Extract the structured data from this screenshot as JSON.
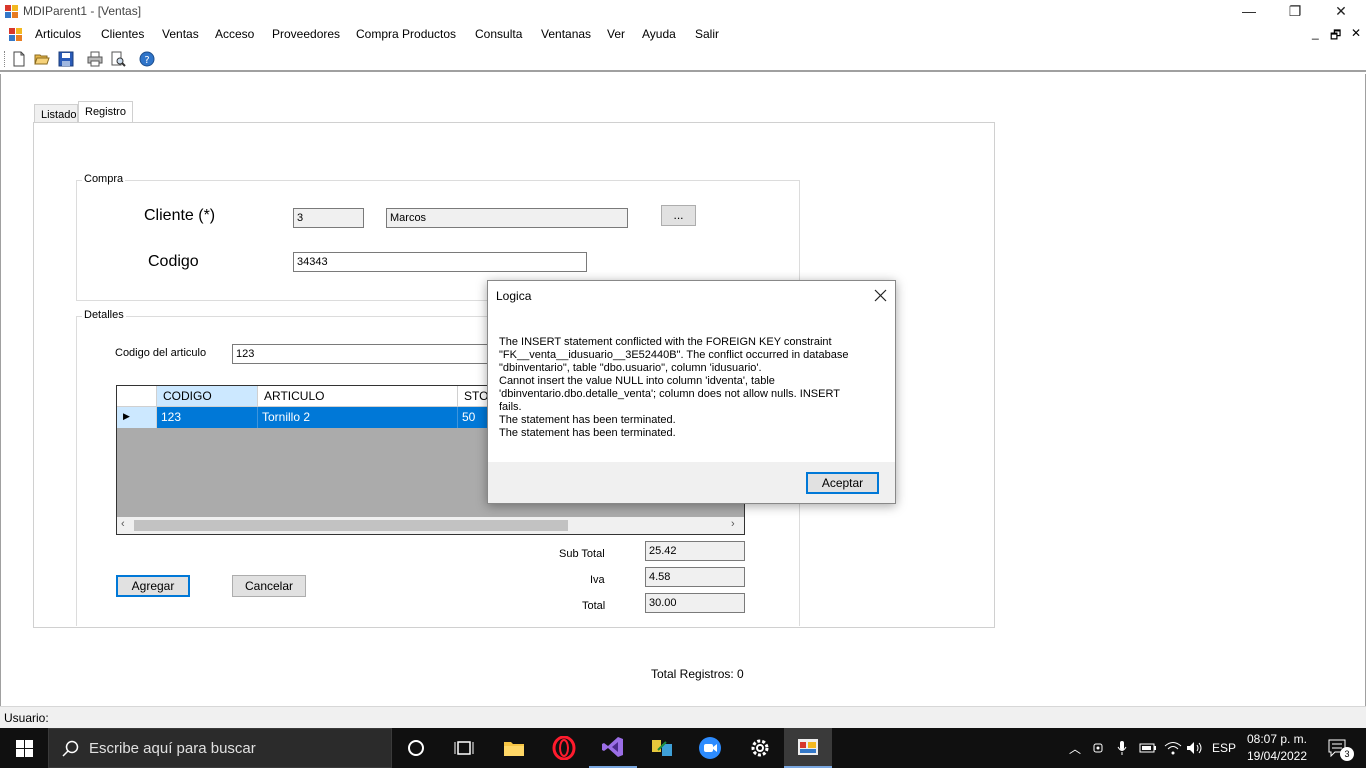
{
  "window": {
    "title": "MDIParent1 - [Ventas]",
    "controls": {
      "minimize": "—",
      "restore": "❐",
      "close": "✕"
    }
  },
  "menu": {
    "items": [
      "Articulos",
      "Clientes",
      "Ventas",
      "Acceso",
      "Proveedores",
      "Compra Productos",
      "Consulta",
      "Ventanas",
      "Ver",
      "Ayuda",
      "Salir"
    ],
    "mdi_controls": {
      "minimize": "_",
      "restore": "🗗",
      "close": "✕"
    }
  },
  "toolbar": {
    "icons": [
      "new-file-icon",
      "open-folder-icon",
      "save-icon",
      "print-icon",
      "print-preview-icon",
      "help-icon"
    ]
  },
  "tabs": [
    {
      "label": "Listado"
    },
    {
      "label": "Registro",
      "active": true
    }
  ],
  "compra": {
    "group_label": "Compra",
    "cliente_label": "Cliente (*)",
    "cliente_id": "3",
    "cliente_nombre": "Marcos",
    "browse_label": "...",
    "codigo_label": "Codigo",
    "codigo_value": "34343"
  },
  "detalles": {
    "group_label": "Detalles",
    "codigo_articulo_label": "Codigo del articulo",
    "codigo_articulo_value": "123",
    "grid": {
      "columns": [
        "CODIGO",
        "ARTICULO",
        "STOCK"
      ],
      "rows": [
        {
          "codigo": "123",
          "articulo": "Tornillo 2",
          "stock": "50"
        }
      ]
    },
    "subtotal_label": "Sub Total",
    "subtotal_value": "25.42",
    "iva_label": "Iva",
    "iva_value": "4.58",
    "total_label": "Total",
    "total_value": "30.00",
    "agregar_label": "Agregar",
    "cancelar_label": "Cancelar"
  },
  "total_registros": "Total Registros: 0",
  "status": {
    "usuario_label": "Usuario:"
  },
  "dialog": {
    "title": "Logica",
    "message": "The INSERT statement conflicted with the FOREIGN KEY constraint\n\"FK__venta__idusuario__3E52440B\". The conflict occurred in database\n\"dbinventario\", table \"dbo.usuario\", column 'idusuario'.\nCannot insert the value NULL into column 'idventa', table\n'dbinventario.dbo.detalle_venta'; column does not allow nulls. INSERT\nfails.\nThe statement has been terminated.\nThe statement has been terminated.",
    "ok_label": "Aceptar"
  },
  "taskbar": {
    "search_placeholder": "Escribe aquí para buscar",
    "language": "ESP",
    "time": "08:07 p. m.",
    "date": "19/04/2022",
    "notification_count": "3"
  }
}
